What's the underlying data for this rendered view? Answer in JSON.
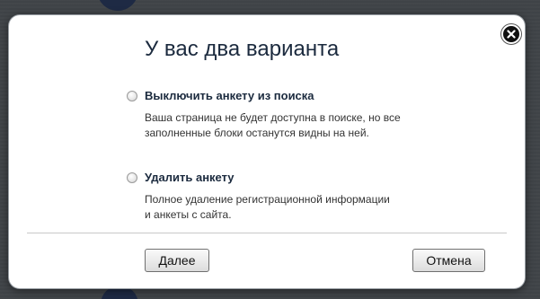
{
  "dialog": {
    "title": "У вас два варианта",
    "close_icon": "close-icon",
    "options": [
      {
        "label": "Выключить анкету из поиска",
        "description_lines": [
          "Ваша страница не будет доступна в поиске, но все",
          "заполненные блоки останутся видны на ней."
        ],
        "selected": false
      },
      {
        "label": "Удалить анкету",
        "description_lines": [
          "Полное удаление регистрационной информации",
          "и анкеты с сайта."
        ],
        "selected": false
      }
    ],
    "buttons": {
      "next_label": "Далее",
      "cancel_label": "Отмена"
    }
  }
}
